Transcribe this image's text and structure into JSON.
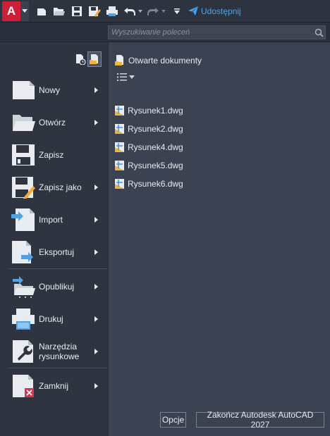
{
  "toolbar": {
    "logo_letter": "A",
    "share_label": "Udostępnij"
  },
  "search": {
    "placeholder": "Wyszukiwanie poleceń"
  },
  "menu": {
    "items": [
      {
        "label": "Nowy",
        "has_submenu": true
      },
      {
        "label": "Otwórz",
        "has_submenu": true
      },
      {
        "label": "Zapisz",
        "has_submenu": false
      },
      {
        "label": "Zapisz jako",
        "has_submenu": true
      },
      {
        "label": "Import",
        "has_submenu": true
      },
      {
        "label": "Eksportuj",
        "has_submenu": true
      },
      {
        "label": "Opublikuj",
        "has_submenu": true
      },
      {
        "label": "Drukuj",
        "has_submenu": true
      },
      {
        "label": "Narzędzia rysunkowe",
        "has_submenu": true
      },
      {
        "label": "Zamknij",
        "has_submenu": true
      }
    ]
  },
  "documents": {
    "title": "Otwarte dokumenty",
    "files": [
      "Rysunek1.dwg",
      "Rysunek2.dwg",
      "Rysunek4.dwg",
      "Rysunek5.dwg",
      "Rysunek6.dwg"
    ]
  },
  "footer": {
    "options_label": "Opcje",
    "exit_label": "Zakończ Autodesk AutoCAD 2027"
  },
  "colors": {
    "brand_red": "#cf1f37",
    "share_blue": "#4fa3e6",
    "panel_left": "#2f3540",
    "panel_right": "#3b4251"
  }
}
